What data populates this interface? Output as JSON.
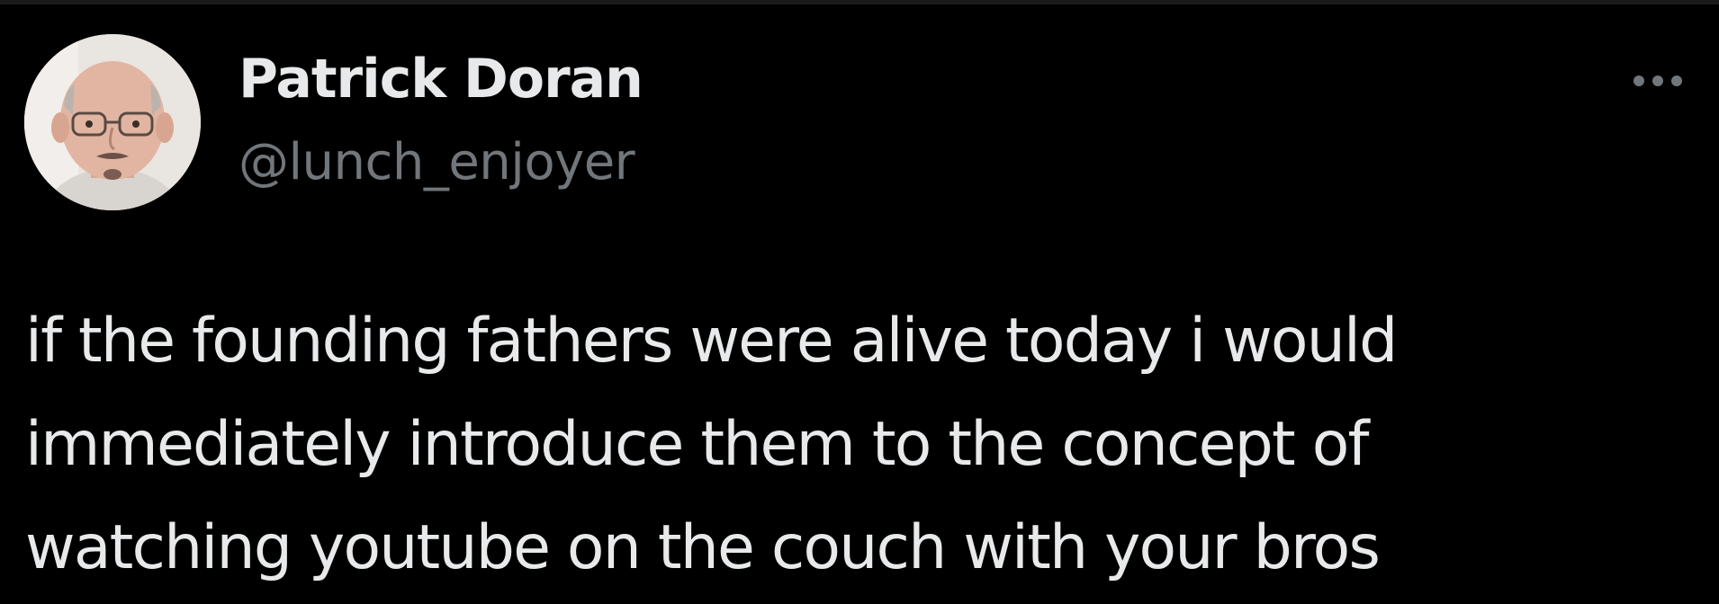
{
  "author": {
    "display_name": "Patrick Doran",
    "handle": "@lunch_enjoyer"
  },
  "tweet": {
    "lines": [
      "if the founding fathers were alive today i would",
      "immediately introduce them to the concept of",
      "watching youtube on the couch with your bros"
    ]
  },
  "icons": {
    "more": "more-horizontal-icon",
    "avatar": "profile-photo"
  },
  "colors": {
    "background": "#000000",
    "primary_text": "#e7e9ea",
    "secondary_text": "#71767b"
  }
}
